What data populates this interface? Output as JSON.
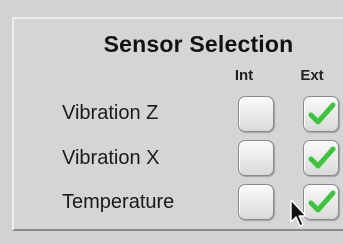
{
  "panel": {
    "title": "Sensor Selection",
    "columns": {
      "int": "Int",
      "ext": "Ext"
    },
    "rows": [
      {
        "label": "Vibration Z",
        "int_checked": false,
        "ext_checked": true
      },
      {
        "label": "Vibration X",
        "int_checked": false,
        "ext_checked": true
      },
      {
        "label": "Temperature",
        "int_checked": false,
        "ext_checked": true
      }
    ]
  },
  "colors": {
    "check": "#3cc43c",
    "panel": "#d5d5d5"
  },
  "icons": {
    "check": "check-icon",
    "cursor": "mouse-pointer-icon"
  }
}
